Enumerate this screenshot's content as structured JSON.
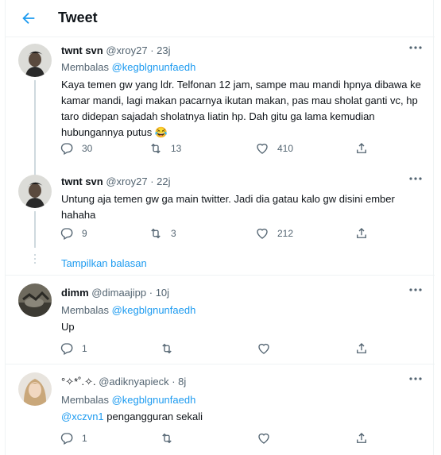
{
  "header": {
    "title": "Tweet"
  },
  "tweets": [
    {
      "name": "twnt svn",
      "handle": "@xroy27",
      "time": "· 23j",
      "reply_prefix": "Membalas",
      "reply_to": "@kegblgnunfaedh",
      "text": "Kaya temen gw yang ldr. Telfonan 12 jam, sampe mau mandi hpnya dibawa ke kamar mandi, lagi makan pacarnya ikutan makan, pas mau sholat ganti vc, hp taro didepan sajadah sholatnya liatin hp. Dah gitu ga lama kemudian hubungannya putus 😂",
      "replies": "30",
      "retweets": "13",
      "likes": "410"
    },
    {
      "name": "twnt svn",
      "handle": "@xroy27",
      "time": "· 22j",
      "text": "Untung aja temen gw ga main twitter. Jadi dia gatau kalo gw disini ember hahaha",
      "replies": "9",
      "retweets": "3",
      "likes": "212"
    },
    {
      "name": "dimm",
      "handle": "@dimaajipp",
      "time": "· 10j",
      "reply_prefix": "Membalas",
      "reply_to": "@kegblgnunfaedh",
      "text": "Up",
      "replies": "1",
      "retweets": "",
      "likes": ""
    },
    {
      "name": "°✧*˚.✧.",
      "handle": "@adiknyapieck",
      "time": "· 8j",
      "reply_prefix": "Membalas",
      "reply_to": "@kegblgnunfaedh",
      "text_mention": "@xczvn1",
      "text": " pengangguran sekali",
      "replies": "1",
      "retweets": "",
      "likes": ""
    }
  ],
  "show_replies": "Tampilkan balasan",
  "icons": {
    "back": "arrow-left-icon",
    "more": "more-horizontal-icon",
    "reply": "reply-icon",
    "retweet": "retweet-icon",
    "like": "heart-icon",
    "share": "share-icon"
  },
  "colors": {
    "accent": "#1d9bf0",
    "muted": "#536471",
    "text": "#0f1419",
    "border": "#eff3f4"
  }
}
